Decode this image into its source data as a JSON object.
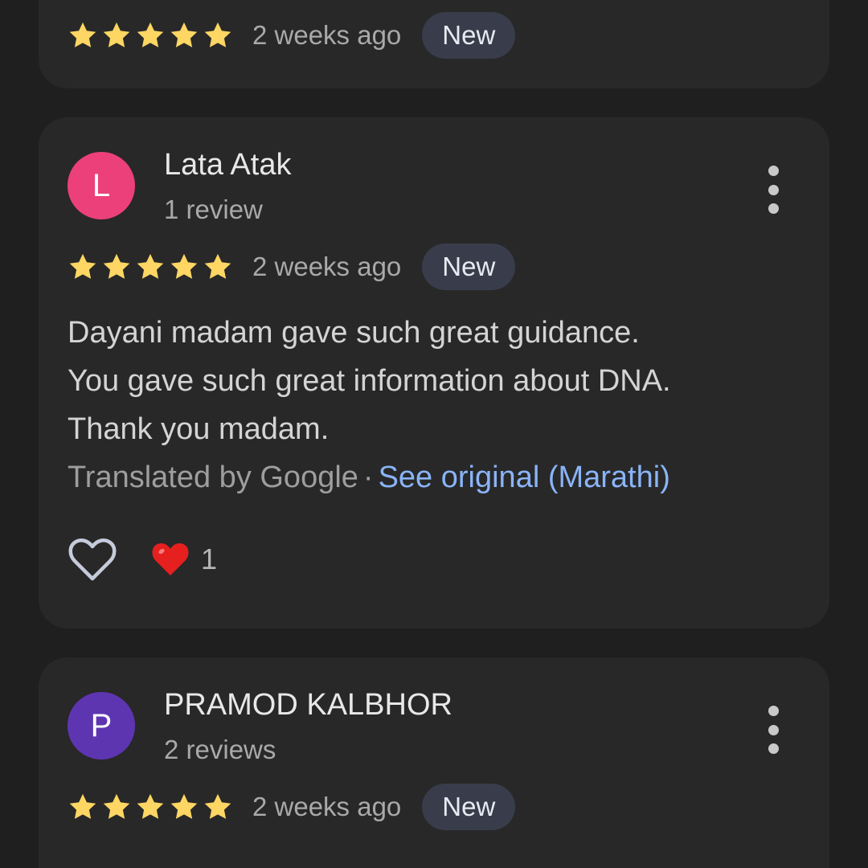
{
  "colors": {
    "background": "#1f1f1f",
    "card": "#282828",
    "star": "#fdd663",
    "badge_bg": "#393d4b",
    "link": "#8ab4f8",
    "heart_outline": "#c6cbdc",
    "heart_filled": "#e5201f"
  },
  "reviews": [
    {
      "rating": 5,
      "time_ago": "2 weeks ago",
      "badge": "New"
    },
    {
      "avatar_letter": "L",
      "avatar_color": "#ec407a",
      "name": "Lata Atak",
      "review_count": "1 review",
      "rating": 5,
      "time_ago": "2 weeks ago",
      "badge": "New",
      "text_lines": [
        "Dayani madam gave such great guidance.",
        "You gave such great information about DNA.",
        "Thank you madam."
      ],
      "translated_by": "Translated by Google",
      "separator": "·",
      "see_original": "See original (Marathi)",
      "reaction_icon": "heart-emoji",
      "reaction_count": "1"
    },
    {
      "avatar_letter": "P",
      "avatar_color": "#5e35b1",
      "name": "PRAMOD KALBHOR",
      "review_count": "2 reviews",
      "rating": 5,
      "time_ago": "2 weeks ago",
      "badge": "New"
    }
  ]
}
